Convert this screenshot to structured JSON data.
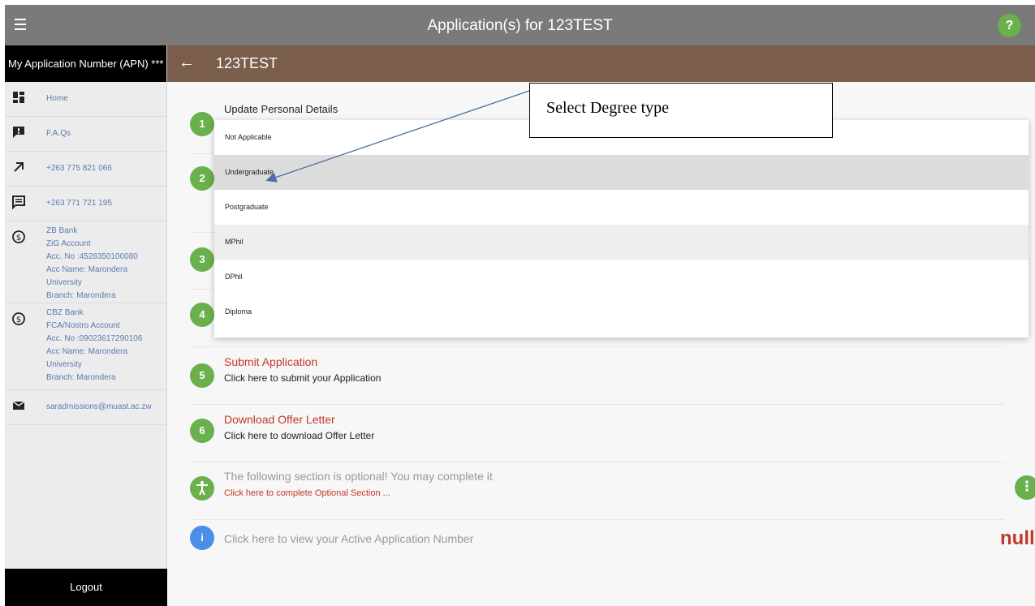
{
  "header": {
    "title": "Application(s) for 123TEST",
    "help_icon": "help-icon",
    "help_label": "?"
  },
  "sidebar": {
    "apn": "My Application Number (APN) ***",
    "items": [
      {
        "icon": "dashboard-icon",
        "label": "Home"
      },
      {
        "icon": "faq-icon",
        "label": "F.A.Qs"
      },
      {
        "icon": "arrow-outward-icon",
        "label": "+263 775 821 066"
      },
      {
        "icon": "message-icon",
        "label": "+263 771 721 195"
      }
    ],
    "bank1": [
      "ZB Bank",
      "ZiG Account",
      "Acc. No :4528350100080",
      "Acc Name: Marondera",
      "University",
      "Branch: Marondera"
    ],
    "bank2": [
      "CBZ Bank",
      "FCA/Nostro Account",
      "Acc. No :09023617290106",
      "Acc Name: Marondera",
      "University",
      "Branch: Marondera"
    ],
    "email": "saradmissions@muast.ac.zw",
    "logout": "Logout"
  },
  "subheader": {
    "back": "←",
    "code": "123TEST"
  },
  "steps": {
    "s1_title": "Update Personal Details",
    "s5_title": "Submit Application",
    "s5_sub": "Click here to submit your Application",
    "s6_title": "Download Offer Letter",
    "s6_sub": "Click here to download Offer Letter",
    "optional_text": "The following section is optional! You may complete it",
    "optional_link": "Click here to complete Optional Section ...",
    "active_apn": "Click here to view your Active Application Number",
    "null_value": "null",
    "numbers": [
      "1",
      "2",
      "3",
      "4",
      "5",
      "6"
    ],
    "info_label": "i",
    "kebab_label": "⋮"
  },
  "dropdown": {
    "options": [
      "Not Applicable",
      "Undergraduate",
      "Postgraduate",
      "MPhil",
      "DPhil",
      "Diploma"
    ],
    "highlighted": "Undergraduate"
  },
  "callout": {
    "text": "Select Degree type"
  },
  "colors": {
    "accent_green": "#6ab04c",
    "header_gray": "#7a7a7a",
    "brown": "#7b5d4c",
    "link_red": "#c0392b",
    "info_blue": "#4a8ee8"
  }
}
